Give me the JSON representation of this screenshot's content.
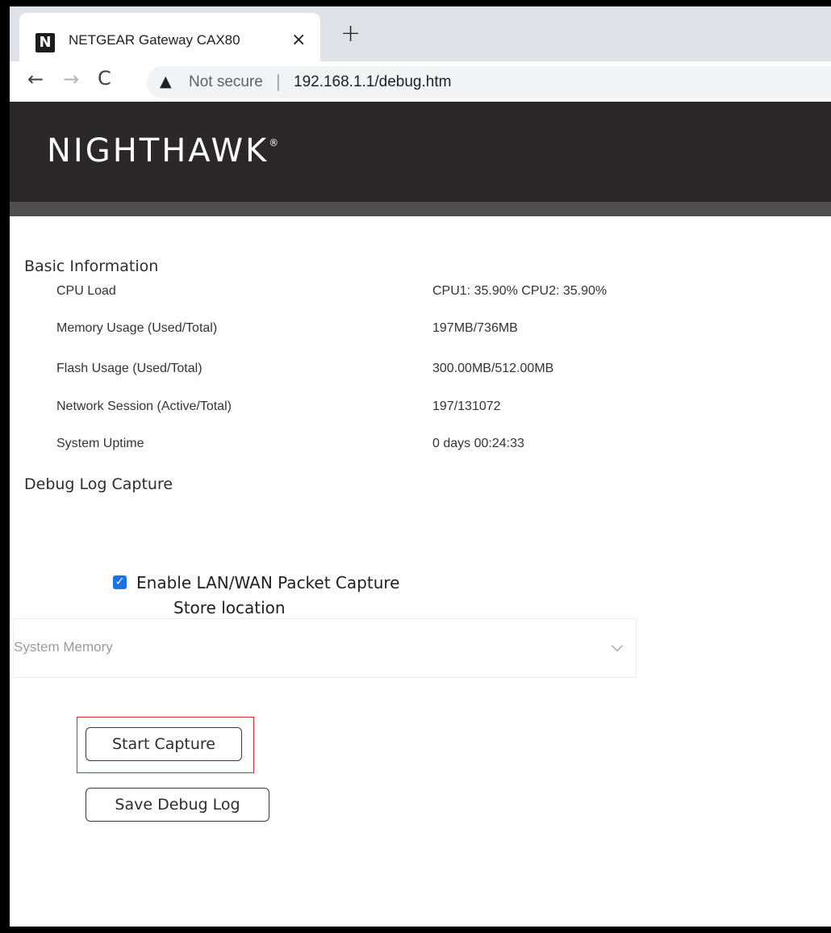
{
  "browser": {
    "tab_favicon": "N",
    "tab_title": "NETGEAR Gateway CAX80",
    "tab_close": "×",
    "new_tab": "+",
    "nav": {
      "back": "←",
      "forward": "→",
      "reload": "C"
    },
    "security_icon": "▲",
    "security_label": "Not secure",
    "url_separator": "|",
    "url": "192.168.1.1/debug.htm"
  },
  "header": {
    "logo": "NIGHTHAWK",
    "logo_mark": "®"
  },
  "basic_info": {
    "title": "Basic Information",
    "rows": [
      {
        "label": "CPU Load",
        "value": "CPU1: 35.90% CPU2: 35.90%"
      },
      {
        "label": "Memory Usage (Used/Total)",
        "value": "197MB/736MB"
      },
      {
        "label": "Flash Usage (Used/Total)",
        "value": "300.00MB/512.00MB"
      },
      {
        "label": "Network Session (Active/Total)",
        "value": "197/131072"
      },
      {
        "label": "System Uptime",
        "value": "0 days 00:24:33"
      }
    ]
  },
  "debug_capture": {
    "title": "Debug Log Capture",
    "checkbox_mark": "✓",
    "enable_label": "Enable LAN/WAN Packet Capture",
    "enable_checked": true,
    "store_location_label": "Store location",
    "store_location_value": "System Memory",
    "start_button": "Start Capture",
    "save_button": "Save Debug Log"
  },
  "colors": {
    "header_bg": "#2b2829",
    "header_bar": "#4f4d4e",
    "checkbox": "#1a73e8",
    "highlight": "#d92b2b"
  }
}
